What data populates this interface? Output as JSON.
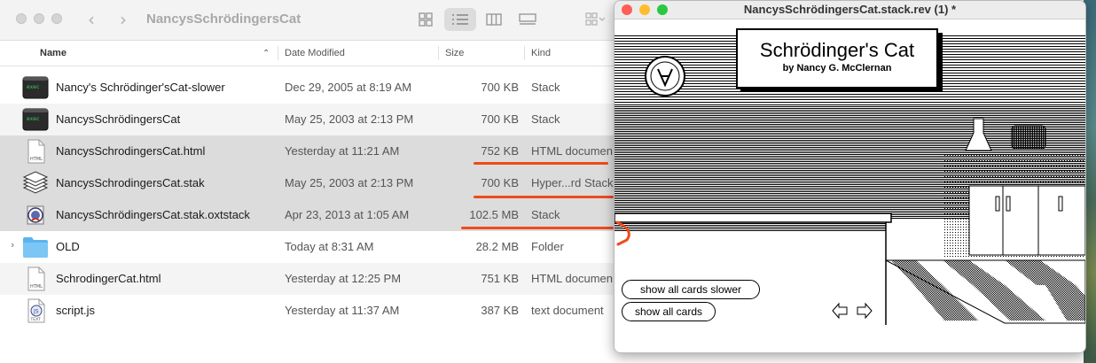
{
  "finder": {
    "title": "NancysSchrödingersCat",
    "columns": {
      "name": "Name",
      "date": "Date Modified",
      "size": "Size",
      "kind": "Kind"
    },
    "rows": [
      {
        "name": "Nancy's Schrödinger'sCat-slower",
        "date": "Dec 29, 2005 at 8:19 AM",
        "size": "700 KB",
        "kind": "Stack",
        "icon": "terminal-icon"
      },
      {
        "name": "NancysSchrödingersCat",
        "date": "May 25, 2003 at 2:13 PM",
        "size": "700 KB",
        "kind": "Stack",
        "icon": "terminal-icon"
      },
      {
        "name": "NancysSchrodingersCat.html",
        "date": "Yesterday at 11:21 AM",
        "size": "752 KB",
        "kind": "HTML documen",
        "icon": "html-file-icon",
        "icon_label": "HTML"
      },
      {
        "name": "NancysSchrodingersCat.stak",
        "date": "May 25, 2003 at 2:13 PM",
        "size": "700 KB",
        "kind": "Hyper...rd Stack",
        "icon": "hypercard-stack-icon"
      },
      {
        "name": "NancysSchrödingersCat.stak.oxtstack",
        "date": "Apr 23, 2013 at 1:05 AM",
        "size": "102.5 MB",
        "kind": "Stack",
        "icon": "livecode-stack-icon"
      },
      {
        "name": "OLD",
        "date": "Today at 8:31 AM",
        "size": "28.2 MB",
        "kind": "Folder",
        "icon": "folder-icon"
      },
      {
        "name": "SchrodingerCat.html",
        "date": "Yesterday at 12:25 PM",
        "size": "751 KB",
        "kind": "HTML documen",
        "icon": "html-file-icon",
        "icon_label": "HTML"
      },
      {
        "name": "script.js",
        "date": "Yesterday at 11:37 AM",
        "size": "387 KB",
        "kind": "text document",
        "icon": "js-file-icon",
        "icon_label": "TEXT"
      }
    ]
  },
  "stack_window": {
    "title": "NancysSchrödingersCat.stack.rev (1) *",
    "card_title": "Schrödinger's Cat",
    "card_subtitle": "by Nancy G. McClernan",
    "buttons": {
      "slower": "show all cards slower",
      "all": "show all cards"
    }
  },
  "colors": {
    "annotation": "#ef4a1c",
    "selection": "#dcdcdc",
    "close": "#fe5f57",
    "minimize": "#febc2e",
    "zoom": "#28c840"
  }
}
